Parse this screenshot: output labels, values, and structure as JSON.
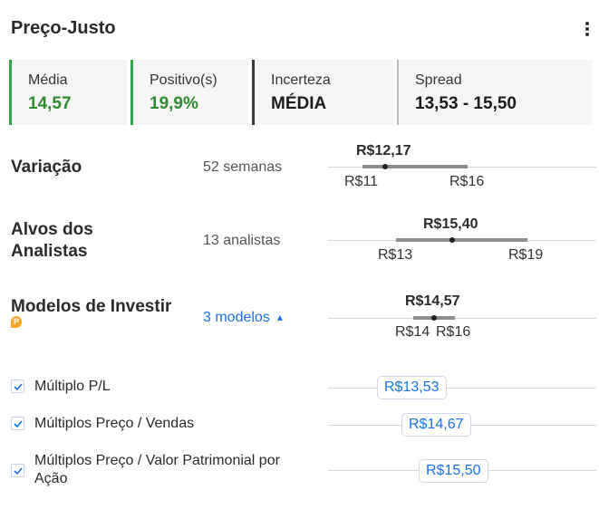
{
  "header": {
    "title": "Preço-Justo"
  },
  "cards": [
    {
      "label": "Média",
      "value": "14,57",
      "color": "#2e8b2e"
    },
    {
      "label": "Positivo(s)",
      "value": "19,9%",
      "color": "#2e8b2e"
    },
    {
      "label": "Incerteza",
      "value": "MÉDIA",
      "color": "#2a2a2a"
    },
    {
      "label": "Spread",
      "value": "13,53 - 15,50",
      "color": "#2a2a2a"
    }
  ],
  "variacao": {
    "title": "Variação",
    "sub": "52 semanas",
    "current": "R$12,17",
    "low": "R$11",
    "high": "R$16"
  },
  "alvos": {
    "title_line1": "Alvos dos",
    "title_line2": "Analistas",
    "sub": "13 analistas",
    "current": "R$15,40",
    "low": "R$13",
    "high": "R$19"
  },
  "modelos": {
    "title": "Modelos de Investir",
    "toggle_label": "3 modelos",
    "current": "R$14,57",
    "low": "R$14",
    "high": "R$16",
    "items": [
      {
        "label": "Múltiplo P/L",
        "value": "R$13,53"
      },
      {
        "label": "Múltiplos Preço / Vendas",
        "value": "R$14,67"
      },
      {
        "label_line1": "Múltiplos Preço / Valor Patrimonial por",
        "label_line2": "Ação",
        "value": "R$15,50"
      }
    ]
  },
  "icons": {
    "menu": "kebab-menu-icon",
    "check": "checkbox-checked-icon",
    "chevron": "chevron-up-icon",
    "brand": "investing-logo-icon"
  }
}
